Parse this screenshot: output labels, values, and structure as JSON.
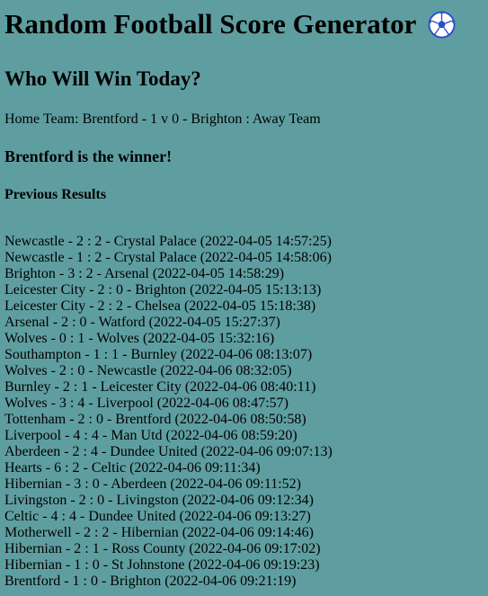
{
  "app": {
    "title": "Random Football Score Generator",
    "subtitle": "Who Will Win Today?",
    "icon": "soccer-ball-icon"
  },
  "current_match": {
    "home_label": "Home Team:",
    "home_team": "Brentford",
    "home_score": "1",
    "separator": "v",
    "away_score": "0",
    "away_team": "Brighton",
    "away_label": "Away Team",
    "line": "Home Team: Brentford - 1 v 0 - Brighton : Away Team",
    "winner_text": "Brentford is the winner!"
  },
  "previous": {
    "title": "Previous Results",
    "results": [
      "Newcastle - 2 : 2 - Crystal Palace (2022-04-05 14:57:25)",
      "Newcastle - 1 : 2 - Crystal Palace (2022-04-05 14:58:06)",
      "Brighton - 3 : 2 - Arsenal (2022-04-05 14:58:29)",
      "Leicester City - 2 : 0 - Brighton (2022-04-05 15:13:13)",
      "Leicester City - 2 : 2 - Chelsea (2022-04-05 15:18:38)",
      "Arsenal - 2 : 0 - Watford (2022-04-05 15:27:37)",
      "Wolves - 0 : 1 - Wolves (2022-04-05 15:32:16)",
      "Southampton - 1 : 1 - Burnley (2022-04-06 08:13:07)",
      "Wolves - 2 : 0 - Newcastle (2022-04-06 08:32:05)",
      "Burnley - 2 : 1 - Leicester City (2022-04-06 08:40:11)",
      "Wolves - 3 : 4 - Liverpool (2022-04-06 08:47:57)",
      "Tottenham - 2 : 0 - Brentford (2022-04-06 08:50:58)",
      "Liverpool - 4 : 4 - Man Utd (2022-04-06 08:59:20)",
      "Aberdeen - 2 : 4 - Dundee United (2022-04-06 09:07:13)",
      "Hearts - 6 : 2 - Celtic (2022-04-06 09:11:34)",
      "Hibernian - 3 : 0 - Aberdeen (2022-04-06 09:11:52)",
      "Livingston - 2 : 0 - Livingston (2022-04-06 09:12:34)",
      "Celtic - 4 : 4 - Dundee United (2022-04-06 09:13:27)",
      "Motherwell - 2 : 2 - Hibernian (2022-04-06 09:14:46)",
      "Hibernian - 2 : 1 - Ross County (2022-04-06 09:17:02)",
      "Hibernian - 1 : 0 - St Johnstone (2022-04-06 09:19:23)",
      "Brentford - 1 : 0 - Brighton (2022-04-06 09:21:19)"
    ]
  },
  "colors": {
    "background": "#5f9ea0",
    "text": "#000000",
    "ball_outline": "#2b4fc9"
  }
}
